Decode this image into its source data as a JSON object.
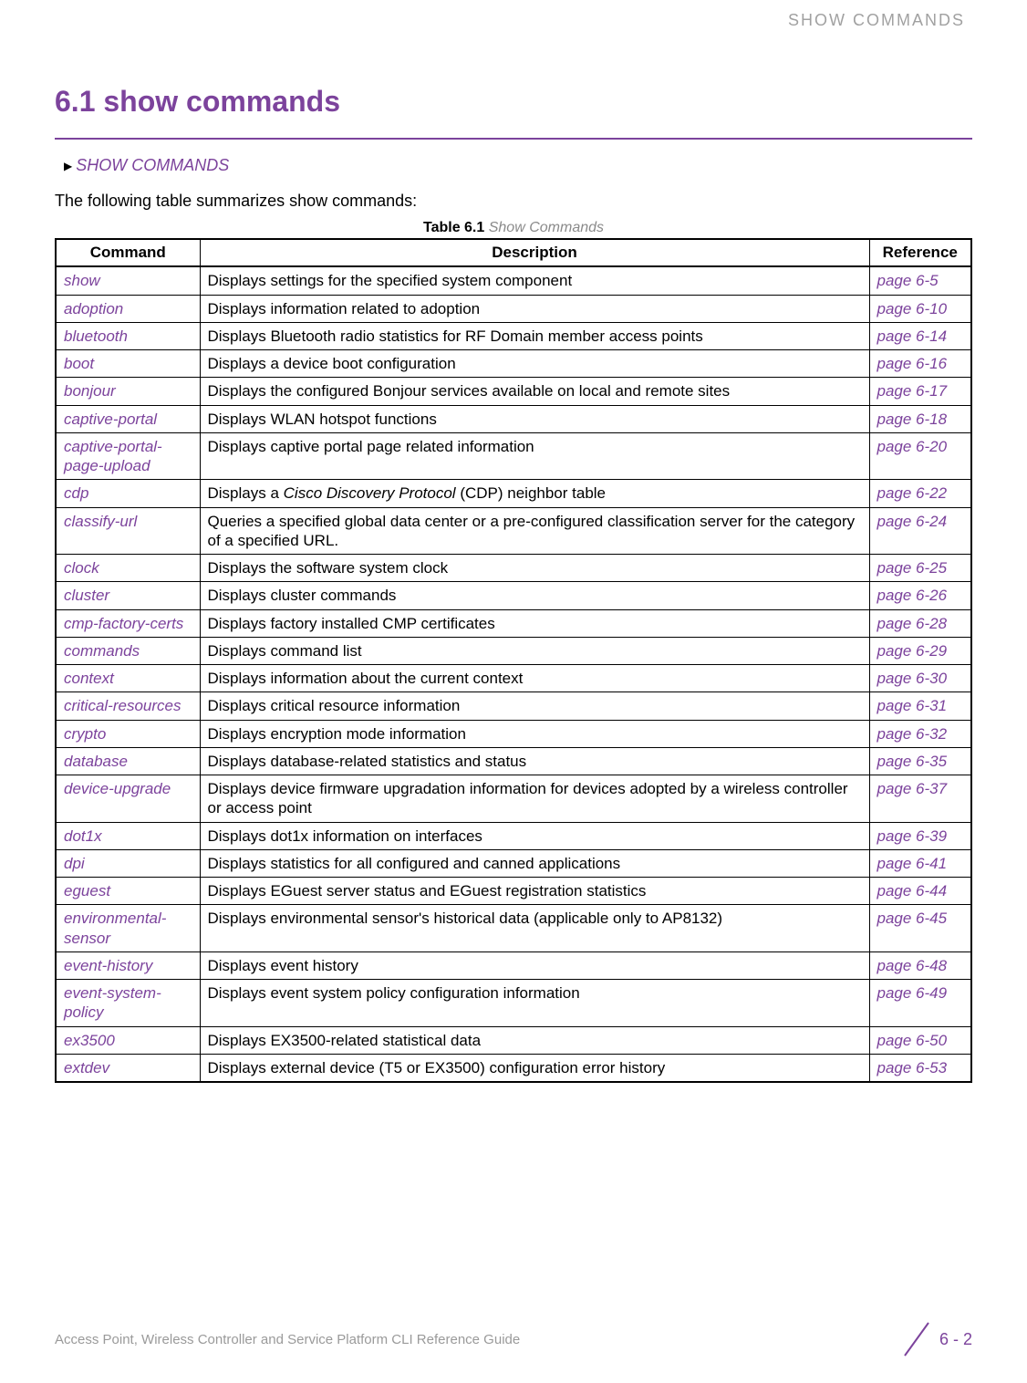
{
  "running_head": "SHOW COMMANDS",
  "section_number": "6.1",
  "section_title": "show commands",
  "breadcrumb": "SHOW COMMANDS",
  "intro": "The following table summarizes show commands:",
  "table_caption_label": "Table 6.1",
  "table_caption_title": "Show Commands",
  "headers": {
    "command": "Command",
    "description": "Description",
    "reference": "Reference"
  },
  "rows": [
    {
      "cmd": "show",
      "desc": "Displays settings for the specified system component",
      "ref": "page 6-5"
    },
    {
      "cmd": "adoption",
      "desc": "Displays information related to adoption",
      "ref": "page 6-10"
    },
    {
      "cmd": "bluetooth",
      "desc": "Displays Bluetooth radio statistics for RF Domain member access points",
      "ref": "page 6-14"
    },
    {
      "cmd": "boot",
      "desc": "Displays a device boot configuration",
      "ref": "page 6-16"
    },
    {
      "cmd": "bonjour",
      "desc": "Displays the configured Bonjour services available on local and remote sites",
      "ref": "page 6-17"
    },
    {
      "cmd": "captive-portal",
      "desc": "Displays WLAN hotspot functions",
      "ref": "page 6-18"
    },
    {
      "cmd": "captive-portal-page-upload",
      "desc": "Displays captive portal page related information",
      "ref": "page 6-20"
    },
    {
      "cmd": "cdp",
      "desc_pre": "Displays a ",
      "desc_em": "Cisco Discovery Protocol",
      "desc_post": " (CDP) neighbor table",
      "ref": "page 6-22"
    },
    {
      "cmd": "classify-url",
      "desc": "Queries a specified global data center or a pre-configured classification server for the category of a specified URL.",
      "ref": "page 6-24"
    },
    {
      "cmd": "clock",
      "desc": "Displays the software system clock",
      "ref": "page 6-25"
    },
    {
      "cmd": "cluster",
      "desc": "Displays cluster commands",
      "ref": "page 6-26"
    },
    {
      "cmd": "cmp-factory-certs",
      "desc": "Displays factory installed CMP certificates",
      "ref": "page 6-28"
    },
    {
      "cmd": "commands",
      "desc": "Displays command list",
      "ref": "page 6-29"
    },
    {
      "cmd": "context",
      "desc": "Displays information about the current context",
      "ref": "page 6-30"
    },
    {
      "cmd": "critical-resources",
      "desc": "Displays critical resource information",
      "ref": "page 6-31"
    },
    {
      "cmd": "crypto",
      "desc": "Displays encryption mode information",
      "ref": "page 6-32"
    },
    {
      "cmd": "database",
      "desc": "Displays database-related statistics and status",
      "ref": "page 6-35"
    },
    {
      "cmd": "device-upgrade",
      "desc": "Displays device firmware upgradation information for devices adopted by a wireless controller or access point",
      "ref": "page 6-37"
    },
    {
      "cmd": "dot1x",
      "desc": "Displays dot1x information on interfaces",
      "ref": "page 6-39"
    },
    {
      "cmd": "dpi",
      "desc": "Displays statistics for all configured and canned applications",
      "ref": "page 6-41"
    },
    {
      "cmd": "eguest",
      "desc": "Displays EGuest server status and EGuest registration statistics",
      "ref": "page 6-44"
    },
    {
      "cmd": "environmental-sensor",
      "desc": "Displays environmental sensor's historical data (applicable only to AP8132)",
      "ref": "page 6-45"
    },
    {
      "cmd": "event-history",
      "desc": "Displays event history",
      "ref": "page 6-48"
    },
    {
      "cmd": "event-system-policy",
      "desc": "Displays event system policy configuration information",
      "ref": "page 6-49"
    },
    {
      "cmd": "ex3500",
      "desc": "Displays EX3500-related statistical data",
      "ref": "page 6-50"
    },
    {
      "cmd": "extdev",
      "desc": "Displays external device (T5 or EX3500) configuration error history",
      "ref": "page 6-53"
    }
  ],
  "footer_left": "Access Point, Wireless Controller and Service Platform CLI Reference Guide",
  "footer_page": "6 - 2"
}
